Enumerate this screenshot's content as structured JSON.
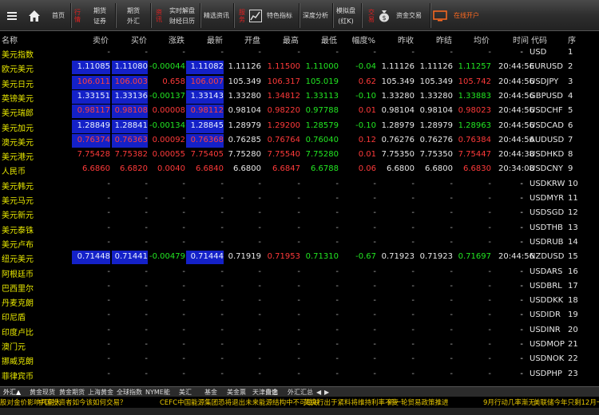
{
  "toolbar": {
    "home": "首页",
    "trade_v": "行情",
    "futures": "期货",
    "securities": "证券",
    "spot": "期货",
    "forex": "外汇",
    "info_v": "资讯",
    "realtime": "实时解盘",
    "calendar": "财经日历",
    "pick": "精选资讯",
    "features": "特色指标",
    "depth": "深度分析",
    "mock": "模拟盘",
    "mock_sub": "(红K)",
    "trade_v2": "交易",
    "fund_trade": "资金交易",
    "online": "在线开户"
  },
  "headers": [
    "名称",
    "卖价",
    "买价",
    "涨跌",
    "最新",
    "开盘",
    "最高",
    "最低",
    "幅度%",
    "昨收",
    "昨结",
    "均价",
    "时间",
    "代码",
    "序"
  ],
  "rows": [
    {
      "name": "美元指数",
      "sell": "-",
      "buy": "-",
      "chg": "-",
      "last": "-",
      "open": "-",
      "high": "-",
      "low": "-",
      "pct": "-",
      "prev": "-",
      "settle": "-",
      "avg": "-",
      "time": "-",
      "code": "USD",
      "idx": "1",
      "hl": false,
      "dir": "none"
    },
    {
      "name": "欧元美元",
      "sell": "1.11085",
      "buy": "1.11080",
      "chg": "-0.00044",
      "last": "1.11082",
      "open": "1.11126",
      "high": "1.11500",
      "low": "1.11000",
      "pct": "-0.04",
      "prev": "1.11126",
      "settle": "1.11126",
      "avg": "1.11257",
      "time": "20:44:56",
      "code": "EURUSD",
      "idx": "2",
      "hl": true,
      "dir": "down"
    },
    {
      "name": "美元日元",
      "sell": "106.011",
      "buy": "106.003",
      "chg": "0.658",
      "last": "106.007",
      "open": "105.349",
      "high": "106.317",
      "low": "105.019",
      "pct": "0.62",
      "prev": "105.349",
      "settle": "105.349",
      "avg": "105.742",
      "time": "20:44:56",
      "code": "USDJPY",
      "idx": "3",
      "hl": true,
      "dir": "up"
    },
    {
      "name": "英镑美元",
      "sell": "1.33151",
      "buy": "1.33136",
      "chg": "-0.00137",
      "last": "1.33143",
      "open": "1.33280",
      "high": "1.34812",
      "low": "1.33113",
      "pct": "-0.10",
      "prev": "1.33280",
      "settle": "1.33280",
      "avg": "1.33883",
      "time": "20:44:56",
      "code": "GBPUSD",
      "idx": "4",
      "hl": true,
      "dir": "down"
    },
    {
      "name": "美元瑞郎",
      "sell": "0.98117",
      "buy": "0.98108",
      "chg": "0.00008",
      "last": "0.98112",
      "open": "0.98104",
      "high": "0.98220",
      "low": "0.97788",
      "pct": "0.01",
      "prev": "0.98104",
      "settle": "0.98104",
      "avg": "0.98023",
      "time": "20:44:56",
      "code": "USDCHF",
      "idx": "5",
      "hl": true,
      "dir": "up"
    },
    {
      "name": "美元加元",
      "sell": "1.28849",
      "buy": "1.28841",
      "chg": "-0.00134",
      "last": "1.28845",
      "open": "1.28979",
      "high": "1.29200",
      "low": "1.28579",
      "pct": "-0.10",
      "prev": "1.28979",
      "settle": "1.28979",
      "avg": "1.28963",
      "time": "20:44:56",
      "code": "USDCAD",
      "idx": "6",
      "hl": true,
      "dir": "down"
    },
    {
      "name": "澳元美元",
      "sell": "0.76374",
      "buy": "0.76363",
      "chg": "0.00092",
      "last": "0.76368",
      "open": "0.76285",
      "high": "0.76764",
      "low": "0.76040",
      "pct": "0.12",
      "prev": "0.76276",
      "settle": "0.76276",
      "avg": "0.76384",
      "time": "20:44:56",
      "code": "AUDUSD",
      "idx": "7",
      "hl": true,
      "dir": "up"
    },
    {
      "name": "美元港元",
      "sell": "7.75428",
      "buy": "7.75382",
      "chg": "0.00055",
      "last": "7.75405",
      "open": "7.75280",
      "high": "7.75540",
      "low": "7.75280",
      "pct": "0.01",
      "prev": "7.75350",
      "settle": "7.75350",
      "avg": "7.75447",
      "time": "20:44:38",
      "code": "USDHKD",
      "idx": "8",
      "hl": false,
      "dir": "up"
    },
    {
      "name": "人民币",
      "sell": "6.6860",
      "buy": "6.6820",
      "chg": "0.0040",
      "last": "6.6840",
      "open": "6.6800",
      "high": "6.6847",
      "low": "6.6788",
      "pct": "0.06",
      "prev": "6.6800",
      "settle": "6.6800",
      "avg": "6.6830",
      "time": "20:34:08",
      "code": "USDCNY",
      "idx": "9",
      "hl": false,
      "dir": "up"
    },
    {
      "name": "美元韩元",
      "sell": "-",
      "buy": "-",
      "chg": "-",
      "last": "-",
      "open": "-",
      "high": "-",
      "low": "-",
      "pct": "-",
      "prev": "-",
      "settle": "-",
      "avg": "-",
      "time": "-",
      "code": "USDKRW",
      "idx": "10",
      "hl": false,
      "dir": "none"
    },
    {
      "name": "美元马元",
      "sell": "-",
      "buy": "-",
      "chg": "-",
      "last": "-",
      "open": "-",
      "high": "-",
      "low": "-",
      "pct": "-",
      "prev": "-",
      "settle": "-",
      "avg": "-",
      "time": "-",
      "code": "USDMYR",
      "idx": "11",
      "hl": false,
      "dir": "none"
    },
    {
      "name": "美元新元",
      "sell": "-",
      "buy": "-",
      "chg": "-",
      "last": "-",
      "open": "-",
      "high": "-",
      "low": "-",
      "pct": "-",
      "prev": "-",
      "settle": "-",
      "avg": "-",
      "time": "-",
      "code": "USDSGD",
      "idx": "12",
      "hl": false,
      "dir": "none"
    },
    {
      "name": "美元泰铢",
      "sell": "-",
      "buy": "-",
      "chg": "-",
      "last": "-",
      "open": "-",
      "high": "-",
      "low": "-",
      "pct": "-",
      "prev": "-",
      "settle": "-",
      "avg": "-",
      "time": "-",
      "code": "USDTHB",
      "idx": "13",
      "hl": false,
      "dir": "none"
    },
    {
      "name": "美元卢布",
      "sell": "-",
      "buy": "-",
      "chg": "-",
      "last": "-",
      "open": "-",
      "high": "-",
      "low": "-",
      "pct": "-",
      "prev": "-",
      "settle": "-",
      "avg": "-",
      "time": "-",
      "code": "USDRUB",
      "idx": "14",
      "hl": false,
      "dir": "none"
    },
    {
      "name": "纽元美元",
      "sell": "0.71448",
      "buy": "0.71441",
      "chg": "-0.00479",
      "last": "0.71444",
      "open": "0.71919",
      "high": "0.71953",
      "low": "0.71310",
      "pct": "-0.67",
      "prev": "0.71923",
      "settle": "0.71923",
      "avg": "0.71697",
      "time": "20:44:56",
      "code": "NZDUSD",
      "idx": "15",
      "hl": true,
      "dir": "down"
    },
    {
      "name": "阿根廷币",
      "sell": "-",
      "buy": "-",
      "chg": "-",
      "last": "-",
      "open": "-",
      "high": "-",
      "low": "-",
      "pct": "-",
      "prev": "-",
      "settle": "-",
      "avg": "-",
      "time": "-",
      "code": "USDARS",
      "idx": "16",
      "hl": false,
      "dir": "none"
    },
    {
      "name": "巴西里尔",
      "sell": "-",
      "buy": "-",
      "chg": "-",
      "last": "-",
      "open": "-",
      "high": "-",
      "low": "-",
      "pct": "-",
      "prev": "-",
      "settle": "-",
      "avg": "-",
      "time": "-",
      "code": "USDBRL",
      "idx": "17",
      "hl": false,
      "dir": "none"
    },
    {
      "name": "丹麦克朗",
      "sell": "-",
      "buy": "-",
      "chg": "-",
      "last": "-",
      "open": "-",
      "high": "-",
      "low": "-",
      "pct": "-",
      "prev": "-",
      "settle": "-",
      "avg": "-",
      "time": "-",
      "code": "USDDKK",
      "idx": "18",
      "hl": false,
      "dir": "none"
    },
    {
      "name": "印尼盾",
      "sell": "-",
      "buy": "-",
      "chg": "-",
      "last": "-",
      "open": "-",
      "high": "-",
      "low": "-",
      "pct": "-",
      "prev": "-",
      "settle": "-",
      "avg": "-",
      "time": "-",
      "code": "USDIDR",
      "idx": "19",
      "hl": false,
      "dir": "none"
    },
    {
      "name": "印度卢比",
      "sell": "-",
      "buy": "-",
      "chg": "-",
      "last": "-",
      "open": "-",
      "high": "-",
      "low": "-",
      "pct": "-",
      "prev": "-",
      "settle": "-",
      "avg": "-",
      "time": "-",
      "code": "USDINR",
      "idx": "20",
      "hl": false,
      "dir": "none"
    },
    {
      "name": "澳门元",
      "sell": "-",
      "buy": "-",
      "chg": "-",
      "last": "-",
      "open": "-",
      "high": "-",
      "low": "-",
      "pct": "-",
      "prev": "-",
      "settle": "-",
      "avg": "-",
      "time": "-",
      "code": "USDMOP",
      "idx": "21",
      "hl": false,
      "dir": "none"
    },
    {
      "name": "挪威克朗",
      "sell": "-",
      "buy": "-",
      "chg": "-",
      "last": "-",
      "open": "-",
      "high": "-",
      "low": "-",
      "pct": "-",
      "prev": "-",
      "settle": "-",
      "avg": "-",
      "time": "-",
      "code": "USDNOK",
      "idx": "22",
      "hl": false,
      "dir": "none"
    },
    {
      "name": "菲律宾币",
      "sell": "-",
      "buy": "-",
      "chg": "-",
      "last": "-",
      "open": "-",
      "high": "-",
      "low": "-",
      "pct": "-",
      "prev": "-",
      "settle": "-",
      "avg": "-",
      "time": "-",
      "code": "USDPHP",
      "idx": "23",
      "hl": false,
      "dir": "none"
    }
  ],
  "tabs": [
    "外汇▲",
    "黄金现货",
    "黄金期货",
    "上海黄金",
    "全球指数",
    "NYME能",
    "美汇",
    "基金",
    "美金票",
    "天津贵金",
    "自选",
    "外汇汇总"
  ],
  "ticker": [
    "股对金价影响几何大",
    "中国投资者如今该如何交易？",
    "CEFC中国能源集团恐将退出未来能源结构中不可或缺",
    "英央行出于紧料将维持利率不变",
    "新一轮贸易政策推进",
    "9月行动几率渐无",
    "美联储今年只剩12月一"
  ],
  "colors": {
    "up": "#ff3a3a",
    "down": "#22e622",
    "name": "#e8e800",
    "highlight": "#1421c8"
  }
}
